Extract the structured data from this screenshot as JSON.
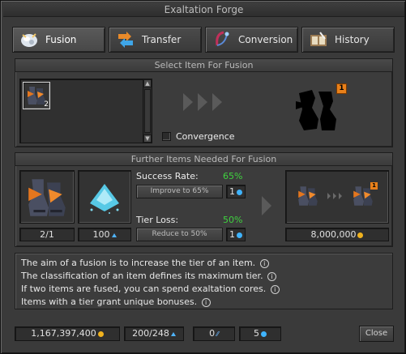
{
  "window": {
    "title": "Exaltation Forge"
  },
  "tabs": [
    {
      "label": "Fusion",
      "icon": "fusion-icon",
      "active": true
    },
    {
      "label": "Transfer",
      "icon": "transfer-icon",
      "active": false
    },
    {
      "label": "Conversion",
      "icon": "conversion-icon",
      "active": false
    },
    {
      "label": "History",
      "icon": "history-icon",
      "active": false
    }
  ],
  "select_panel": {
    "title": "Select Item For Fusion",
    "items": [
      {
        "icon": "boots-icon",
        "count": "2"
      }
    ],
    "convergence_label": "Convergence",
    "convergence_checked": false,
    "preview_tier_badge": "1"
  },
  "needed_panel": {
    "title": "Further Items Needed For Fusion",
    "item_count": "2/1",
    "dust_amount": "100",
    "success_rate_label": "Success Rate:",
    "success_rate_value": "65%",
    "improve_button": "Improve to 65%",
    "improve_cost": "1",
    "tier_loss_label": "Tier Loss:",
    "tier_loss_value": "50%",
    "reduce_button": "Reduce to 50%",
    "reduce_cost": "1",
    "result_tier_badge": "1",
    "price": "8,000,000"
  },
  "info_lines": [
    "The aim of a fusion is to increase the tier of an item.",
    "The classification of an item defines its maximum tier.",
    "If two items are fused, you can spend exaltation cores.",
    "Items with a tier grant unique bonuses."
  ],
  "footer": {
    "gold": "1,167,397,400",
    "dust": "200/248",
    "slivers": "0",
    "cores": "5",
    "close_label": "Close"
  },
  "colors": {
    "accent_green": "#3fd23f",
    "core_blue": "#3fb4ff",
    "gold": "#f0b21e",
    "tier_badge": "#e8801a"
  }
}
